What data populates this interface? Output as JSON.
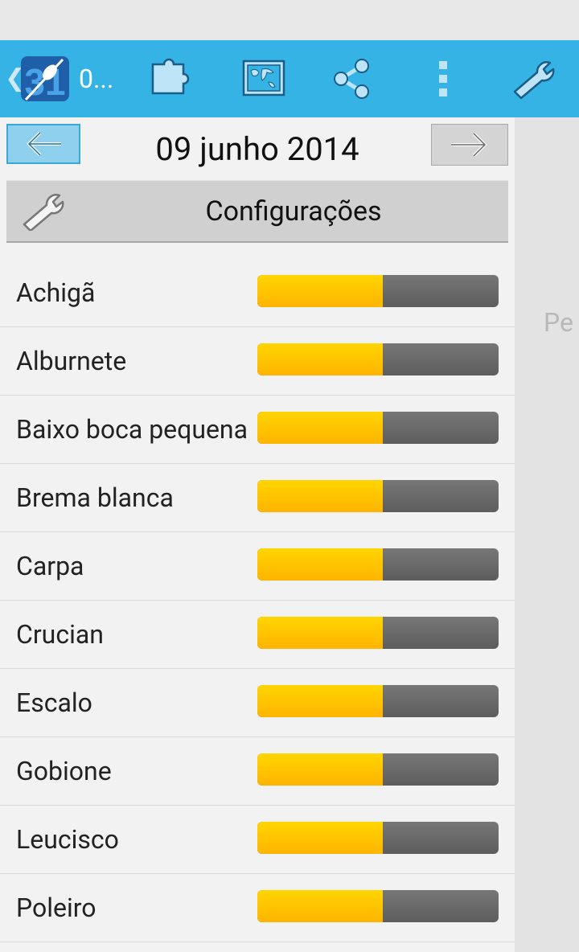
{
  "actionbar": {
    "title": "0...",
    "logo_number": "31",
    "back_glyph": "❮",
    "icons": [
      "puzzle-icon",
      "map-icon",
      "share-icon",
      "overflow-menu-icon",
      "wrench-icon"
    ],
    "color": "#35b3e5"
  },
  "date_nav": {
    "date": "09 junho 2014"
  },
  "settings": {
    "label": "Configurações"
  },
  "side_panel": {
    "text": "Pe"
  },
  "colors": {
    "bar_fill": "#ffc400",
    "bar_track": "#6a6a6a"
  },
  "species": [
    {
      "name": "Achigã",
      "level": 0.52
    },
    {
      "name": "Alburnete",
      "level": 0.52
    },
    {
      "name": "Baixo boca pequena",
      "level": 0.52
    },
    {
      "name": "Brema blanca",
      "level": 0.52
    },
    {
      "name": "Carpa",
      "level": 0.52
    },
    {
      "name": "Crucian",
      "level": 0.52
    },
    {
      "name": "Escalo",
      "level": 0.52
    },
    {
      "name": "Gobione",
      "level": 0.52
    },
    {
      "name": "Leucisco",
      "level": 0.52
    },
    {
      "name": "Poleiro",
      "level": 0.52
    }
  ]
}
